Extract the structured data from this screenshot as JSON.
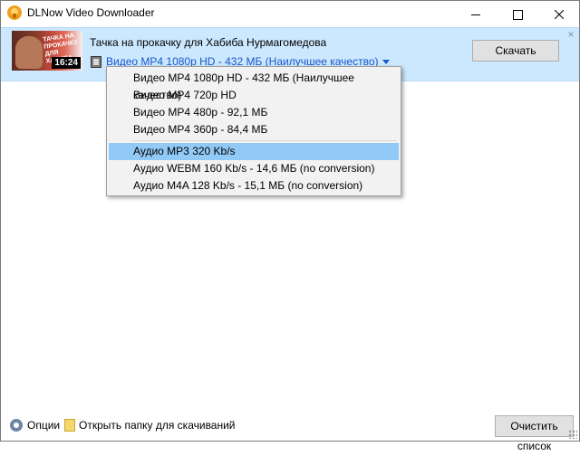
{
  "window": {
    "title": "DLNow Video Downloader"
  },
  "item": {
    "thumbnail_caption": "ТАЧКА НА ПРОКАЧКУ ДЛЯ ХАБИБА",
    "duration": "16:24",
    "title": "Тачка на прокачку для Хабиба Нурмагомедова",
    "selected_format": "Видео MP4 1080p HD - 432 МБ (Наилучшее качество)",
    "download_label": "Скачать",
    "remove_label": "×"
  },
  "dropdown": {
    "video_options": [
      "Видео MP4 1080p HD - 432 МБ (Наилучшее качество)",
      "Видео MP4 720p HD",
      "Видео MP4 480p - 92,1 МБ",
      "Видео MP4 360p - 84,4 МБ"
    ],
    "audio_options": [
      "Аудио MP3 320 Kb/s",
      "Аудио WEBM 160 Kb/s - 14,6 МБ (no conversion)",
      "Аудио M4A 128 Kb/s - 15,1 МБ (no conversion)"
    ],
    "highlighted": "Аудио MP3 320 Kb/s"
  },
  "footer": {
    "options_label": "Опции",
    "open_folder_label": "Открыть папку для скачиваний",
    "clear_list_label": "Очистить список"
  },
  "colors": {
    "item_highlight": "#cce8ff",
    "dropdown_selected": "#91c9f7",
    "link_blue": "#1a56c8"
  }
}
